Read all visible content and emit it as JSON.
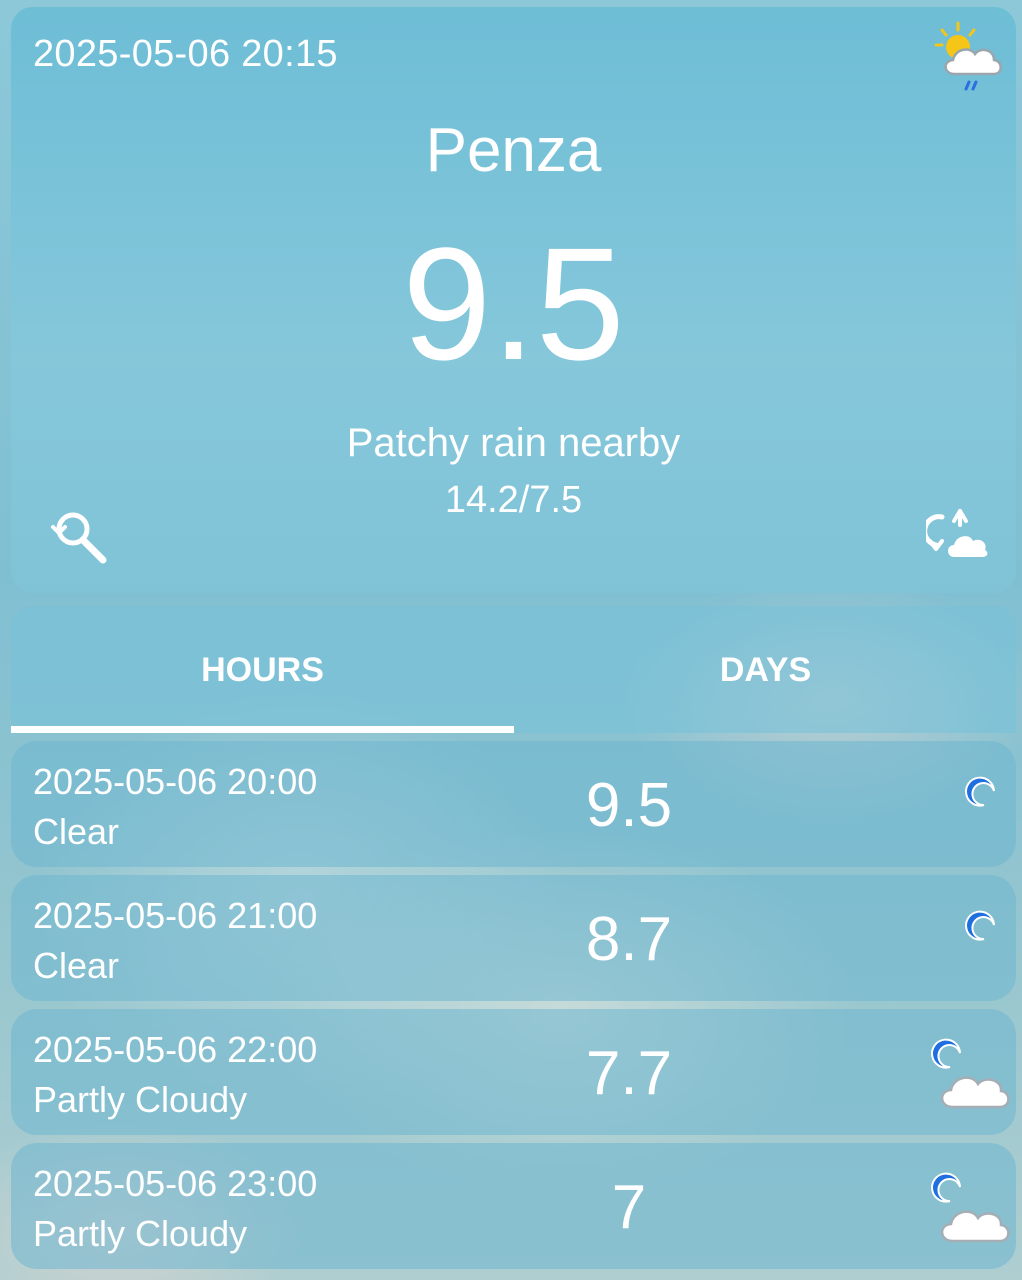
{
  "current": {
    "datetime": "2025-05-06 20:15",
    "city": "Penza",
    "temperature": "9.5",
    "condition": "Patchy rain nearby",
    "minmax": "14.2/7.5",
    "icon": "sun-cloud-rain-icon"
  },
  "tabs": {
    "hours": "HOURS",
    "days": "DAYS",
    "selected": "HOURS"
  },
  "hourly": [
    {
      "time": "2025-05-06 20:00",
      "condition": "Clear",
      "temperature": "9.5",
      "icon": "moon-icon"
    },
    {
      "time": "2025-05-06 21:00",
      "condition": "Clear",
      "temperature": "8.7",
      "icon": "moon-icon"
    },
    {
      "time": "2025-05-06 22:00",
      "condition": "Partly Cloudy",
      "temperature": "7.7",
      "icon": "moon-cloud-icon"
    },
    {
      "time": "2025-05-06 23:00",
      "condition": "Partly Cloudy",
      "temperature": "7",
      "icon": "moon-cloud-icon"
    }
  ],
  "colors": {
    "text": "#ffffff",
    "moon": "#1f6fe0",
    "sun": "#f5c518",
    "rain": "#2a6fe0"
  }
}
